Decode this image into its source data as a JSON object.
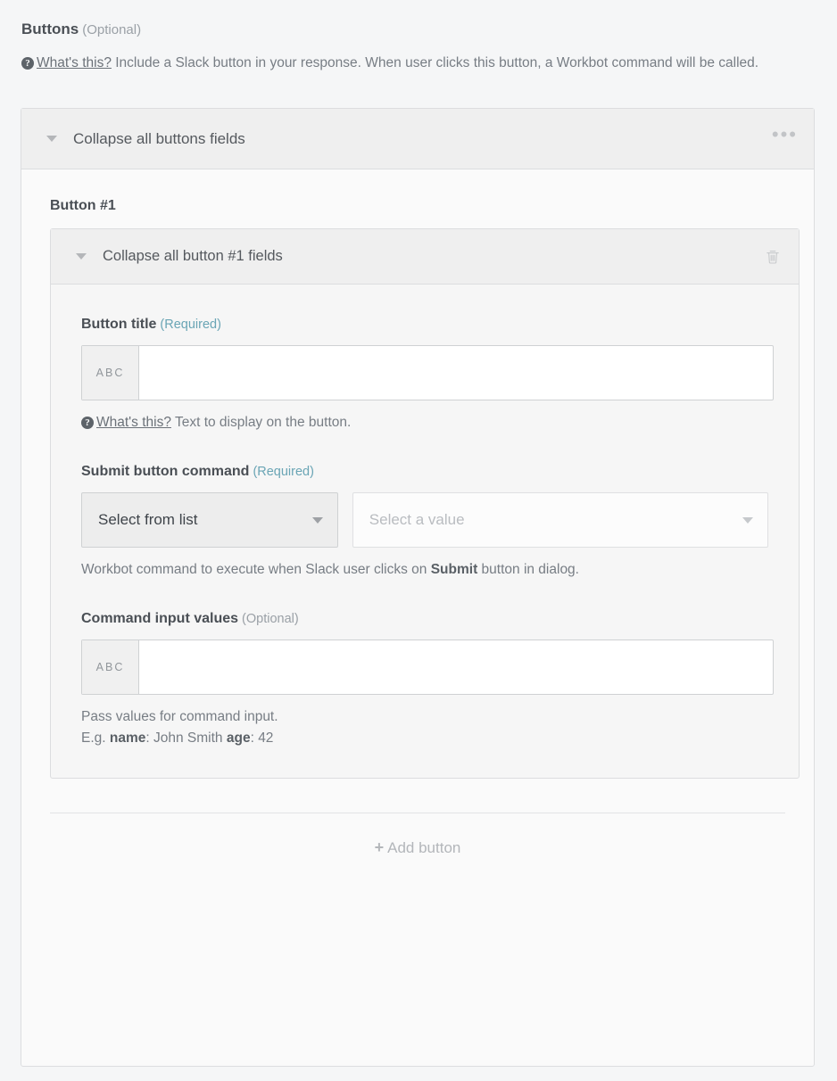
{
  "section": {
    "title": "Buttons",
    "optional_tag": "(Optional)",
    "help_link": "What's this?",
    "help_text": "Include a Slack button in your response. When user clicks this button, a Workbot command will be called.",
    "help_icon": "question-circle-icon"
  },
  "outer_panel": {
    "collapse_label": "Collapse all buttons fields",
    "caret_icon": "chevron-down-icon",
    "menu_icon": "ellipsis-icon",
    "menu_glyph": "•••"
  },
  "button_group": {
    "heading": "Button #1",
    "collapse_label": "Collapse all button #1 fields",
    "caret_icon": "chevron-down-icon",
    "delete_icon": "trash-icon"
  },
  "fields": {
    "button_title": {
      "label": "Button title",
      "requirement": "(Required)",
      "prefix": "ABC",
      "prefix_icon": "abc-text-icon",
      "value": "",
      "placeholder": "",
      "hint_link": "What's this?",
      "hint_icon": "question-circle-icon",
      "hint_text": "Text to display on the button."
    },
    "submit_button_command": {
      "label": "Submit button command",
      "requirement": "(Required)",
      "select_mode": "Select from list",
      "select_value_placeholder": "Select a value",
      "caret_icon": "chevron-down-icon",
      "hint_before": "Workbot command to execute when Slack user clicks on ",
      "hint_bold": "Submit",
      "hint_after": " button in dialog."
    },
    "command_input_values": {
      "label": "Command input values",
      "requirement": "(Optional)",
      "prefix": "ABC",
      "prefix_icon": "abc-text-icon",
      "value": "",
      "placeholder": "",
      "hint_line1": "Pass values for command input.",
      "hint_eg_prefix": "E.g. ",
      "hint_eg_key1": "name",
      "hint_eg_val1": ": John Smith ",
      "hint_eg_key2": "age",
      "hint_eg_val2": ": 42"
    }
  },
  "footer": {
    "add_button_label": "Add button",
    "add_button_plus": "+",
    "add_icon": "plus-icon"
  },
  "colors": {
    "required_accent": "#6aa5b5",
    "muted_text": "#9aa0a6",
    "body_text": "#777d84",
    "heading_text": "#4a4f55",
    "panel_bar": "#efefef",
    "panel_border": "#dcdddf",
    "page_bg": "#f5f6f7"
  }
}
